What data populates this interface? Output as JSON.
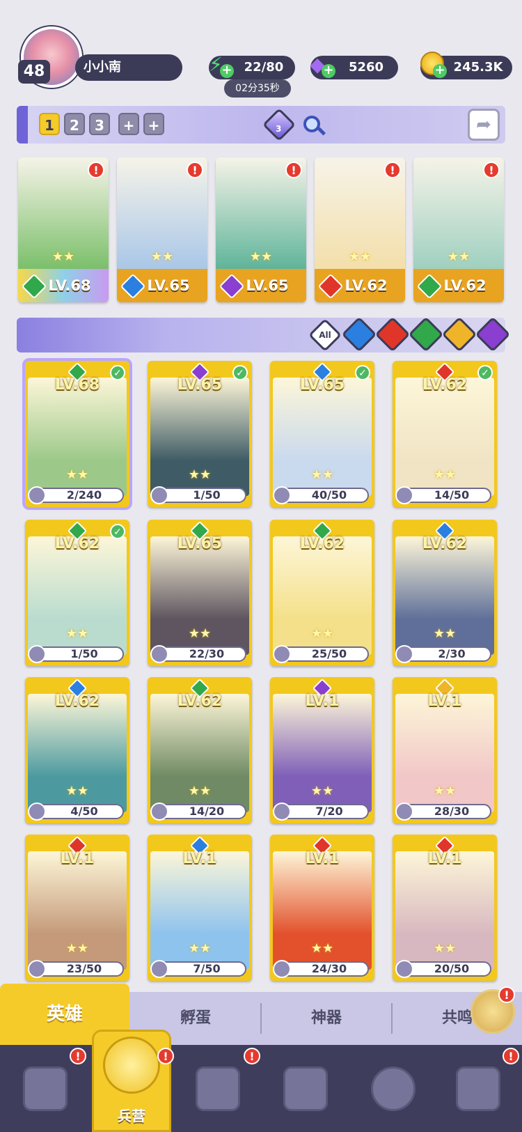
{
  "player": {
    "level": "48",
    "name": "小小南"
  },
  "resources": {
    "energy": {
      "icon": "lightning-icon",
      "value": "22/80",
      "timer": "02分35秒"
    },
    "gems": {
      "icon": "gem-icon",
      "value": "5260"
    },
    "gold": {
      "icon": "coin-icon",
      "value": "245.3K"
    }
  },
  "team": {
    "tabs": [
      "1",
      "2",
      "3",
      "+",
      "+"
    ],
    "active_tab": "1",
    "formation_count": "3"
  },
  "lineup": [
    {
      "level": "LV.68",
      "element": "nature",
      "color": "#31a84a",
      "art": "#7bbf6a",
      "alert": "!"
    },
    {
      "level": "LV.65",
      "element": "water",
      "color": "#2a7fe0",
      "art": "#a9c7e8",
      "alert": "!"
    },
    {
      "level": "LV.65",
      "element": "dark",
      "color": "#8a3fd0",
      "art": "#5fb49a",
      "alert": "!"
    },
    {
      "level": "LV.62",
      "element": "fire",
      "color": "#e0362a",
      "art": "#f3dfaa",
      "alert": "!"
    },
    {
      "level": "LV.62",
      "element": "nature",
      "color": "#31a84a",
      "art": "#9fd0c0",
      "alert": "!"
    }
  ],
  "filters": {
    "all_label": "All",
    "elements": [
      {
        "name": "water",
        "color": "#2a7fe0"
      },
      {
        "name": "fire",
        "color": "#e0362a"
      },
      {
        "name": "nature",
        "color": "#31a84a"
      },
      {
        "name": "light",
        "color": "#f0b428"
      },
      {
        "name": "dark",
        "color": "#8a3fd0"
      }
    ]
  },
  "heroes": [
    {
      "level": "LV.68",
      "shards": "2/240",
      "element": "nature",
      "color": "#31a84a",
      "art": "#9cc98a",
      "check": true,
      "selected": true
    },
    {
      "level": "LV.65",
      "shards": "1/50",
      "element": "dark",
      "color": "#8a3fd0",
      "art": "#3f5c66",
      "check": true
    },
    {
      "level": "LV.65",
      "shards": "40/50",
      "element": "water",
      "color": "#2a7fe0",
      "art": "#c9d9ee",
      "check": true
    },
    {
      "level": "LV.62",
      "shards": "14/50",
      "element": "fire",
      "color": "#e0362a",
      "art": "#f0e4c4",
      "check": true
    },
    {
      "level": "LV.62",
      "shards": "1/50",
      "element": "nature",
      "color": "#31a84a",
      "art": "#b9dccf",
      "check": true
    },
    {
      "level": "LV.65",
      "shards": "22/30",
      "element": "nature",
      "color": "#31a84a",
      "art": "#5e5560",
      "check": false
    },
    {
      "level": "LV.62",
      "shards": "25/50",
      "element": "nature",
      "color": "#31a84a",
      "art": "#f4e08a",
      "check": false
    },
    {
      "level": "LV.62",
      "shards": "2/30",
      "element": "water",
      "color": "#2a7fe0",
      "art": "#5f6f9a",
      "check": false
    },
    {
      "level": "LV.62",
      "shards": "4/50",
      "element": "water",
      "color": "#2a7fe0",
      "art": "#4c9aa0",
      "check": false
    },
    {
      "level": "LV.62",
      "shards": "14/20",
      "element": "nature",
      "color": "#31a84a",
      "art": "#6f8a64",
      "check": false
    },
    {
      "level": "LV.1",
      "shards": "7/20",
      "element": "dark",
      "color": "#8a3fd0",
      "art": "#7f5fb8",
      "check": false
    },
    {
      "level": "LV.1",
      "shards": "28/30",
      "element": "light",
      "color": "#f0b428",
      "art": "#f1c7c7",
      "check": false
    },
    {
      "level": "LV.1",
      "shards": "23/50",
      "element": "fire",
      "color": "#e0362a",
      "art": "#c49a7a",
      "check": false
    },
    {
      "level": "LV.1",
      "shards": "7/50",
      "element": "water",
      "color": "#2a7fe0",
      "art": "#8ec3ee",
      "check": false
    },
    {
      "level": "LV.1",
      "shards": "24/30",
      "element": "fire",
      "color": "#e0362a",
      "art": "#e2512c",
      "check": false
    },
    {
      "level": "LV.1",
      "shards": "20/50",
      "element": "fire",
      "color": "#e0362a",
      "art": "#d8b8c0",
      "check": false
    }
  ],
  "subtabs": [
    "英雄",
    "孵蛋",
    "神器",
    "共鸣"
  ],
  "nav": {
    "active_label": "兵营",
    "items": [
      "cards-icon",
      "barracks-icon",
      "map-icon",
      "castle-icon",
      "mushroom-icon",
      "guild-icon"
    ],
    "alert": "!"
  },
  "colors": {
    "accent": "#f5cb2a",
    "dark": "#3b3b58",
    "alert": "#e53a2f"
  }
}
